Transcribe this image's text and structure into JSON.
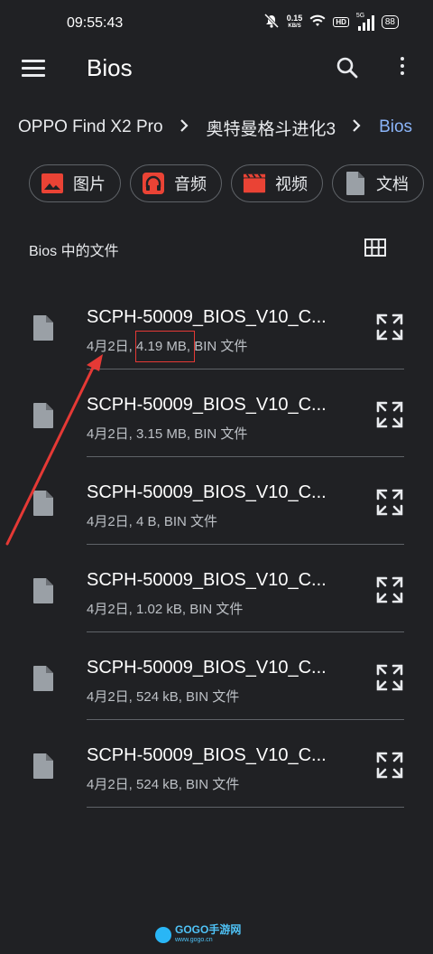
{
  "status_bar": {
    "time": "09:55:43",
    "net_speed": "0.15",
    "net_unit": "KB/S",
    "hd_badge": "HD",
    "signal_label": "5G",
    "battery": "88"
  },
  "app_bar": {
    "title": "Bios",
    "menu_icon": "menu-icon",
    "search_icon": "search-icon",
    "more_icon": "more-vert-icon"
  },
  "breadcrumb": [
    {
      "label": "OPPO Find X2 Pro"
    },
    {
      "label": "奥特曼格斗进化3"
    },
    {
      "label": "Bios"
    }
  ],
  "chips": [
    {
      "label": "图片",
      "icon": "image-icon",
      "color": "#ea4335"
    },
    {
      "label": "音频",
      "icon": "headphones-icon",
      "color": "#ea4335"
    },
    {
      "label": "视频",
      "icon": "video-icon",
      "color": "#ea4335"
    },
    {
      "label": "文档",
      "icon": "document-icon",
      "color": "#9aa0a6"
    }
  ],
  "section": {
    "label": "Bios 中的文件",
    "view_icon": "grid-view-icon"
  },
  "files": [
    {
      "name": "SCPH-50009_BIOS_V10_C...",
      "meta": "4月2日, 4.19 MB, BIN 文件"
    },
    {
      "name": "SCPH-50009_BIOS_V10_C...",
      "meta": "4月2日, 3.15 MB, BIN 文件"
    },
    {
      "name": "SCPH-50009_BIOS_V10_C...",
      "meta": "4月2日, 4 B, BIN 文件"
    },
    {
      "name": "SCPH-50009_BIOS_V10_C...",
      "meta": "4月2日, 1.02 kB, BIN 文件"
    },
    {
      "name": "SCPH-50009_BIOS_V10_C...",
      "meta": "4月2日, 524 kB, BIN 文件"
    },
    {
      "name": "SCPH-50009_BIOS_V10_C...",
      "meta": "4月2日, 524 kB, BIN 文件"
    }
  ],
  "colors": {
    "background": "#202124",
    "accent": "#8ab4f8",
    "annotation": "#e53935"
  },
  "watermark": {
    "text": "GOGO手游网",
    "sub": "www.gogo.cn"
  }
}
